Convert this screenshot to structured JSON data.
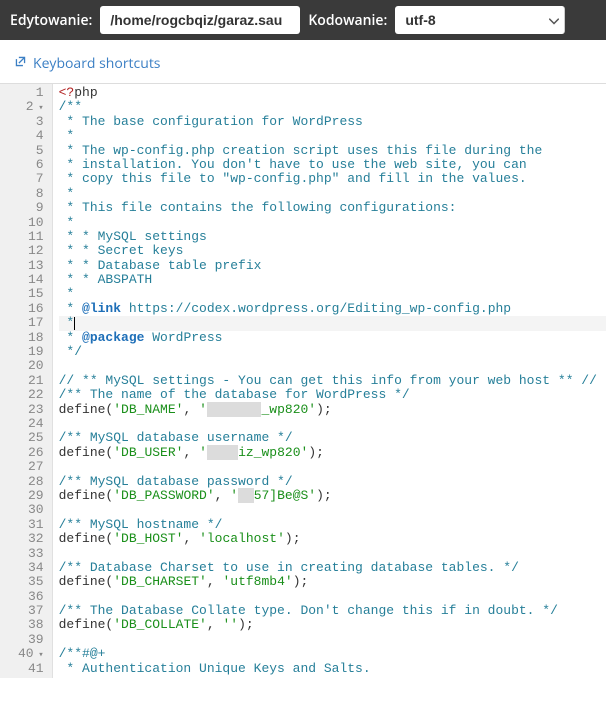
{
  "toolbar": {
    "editing_label": "Edytowanie:",
    "path": "/home/rogcbqiz/garaz.sau",
    "encoding_label": "Kodowanie:",
    "encoding_value": "utf-8"
  },
  "shortcuts": {
    "label": "Keyboard shortcuts"
  },
  "editor": {
    "active_line": 17,
    "fold_lines": [
      2,
      40
    ],
    "lines": [
      {
        "n": 1,
        "seg": [
          {
            "t": "<?",
            "c": "c-tag"
          },
          {
            "t": "php",
            "c": ""
          }
        ]
      },
      {
        "n": 2,
        "seg": [
          {
            "t": "/**",
            "c": "c-comment"
          }
        ]
      },
      {
        "n": 3,
        "seg": [
          {
            "t": " * The base configuration for WordPress",
            "c": "c-comment"
          }
        ]
      },
      {
        "n": 4,
        "seg": [
          {
            "t": " *",
            "c": "c-comment"
          }
        ]
      },
      {
        "n": 5,
        "seg": [
          {
            "t": " * The wp-config.php creation script uses this file during the",
            "c": "c-comment"
          }
        ]
      },
      {
        "n": 6,
        "seg": [
          {
            "t": " * installation. You don't have to use the web site, you can",
            "c": "c-comment"
          }
        ]
      },
      {
        "n": 7,
        "seg": [
          {
            "t": " * copy this file to \"wp-config.php\" and fill in the values.",
            "c": "c-comment"
          }
        ]
      },
      {
        "n": 8,
        "seg": [
          {
            "t": " *",
            "c": "c-comment"
          }
        ]
      },
      {
        "n": 9,
        "seg": [
          {
            "t": " * This file contains the following configurations:",
            "c": "c-comment"
          }
        ]
      },
      {
        "n": 10,
        "seg": [
          {
            "t": " *",
            "c": "c-comment"
          }
        ]
      },
      {
        "n": 11,
        "seg": [
          {
            "t": " * * MySQL settings",
            "c": "c-comment"
          }
        ]
      },
      {
        "n": 12,
        "seg": [
          {
            "t": " * * Secret keys",
            "c": "c-comment"
          }
        ]
      },
      {
        "n": 13,
        "seg": [
          {
            "t": " * * Database table prefix",
            "c": "c-comment"
          }
        ]
      },
      {
        "n": 14,
        "seg": [
          {
            "t": " * * ABSPATH",
            "c": "c-comment"
          }
        ]
      },
      {
        "n": 15,
        "seg": [
          {
            "t": " *",
            "c": "c-comment"
          }
        ]
      },
      {
        "n": 16,
        "seg": [
          {
            "t": " * ",
            "c": "c-comment"
          },
          {
            "t": "@link",
            "c": "c-doctag"
          },
          {
            "t": " https://codex.wordpress.org/Editing_wp-config.php",
            "c": "c-comment"
          }
        ]
      },
      {
        "n": 17,
        "seg": [
          {
            "t": " *",
            "c": "c-comment"
          },
          {
            "t": "",
            "c": "cursor"
          }
        ]
      },
      {
        "n": 18,
        "seg": [
          {
            "t": " * ",
            "c": "c-comment"
          },
          {
            "t": "@package",
            "c": "c-doctag"
          },
          {
            "t": " WordPress",
            "c": "c-comment"
          }
        ]
      },
      {
        "n": 19,
        "seg": [
          {
            "t": " */",
            "c": "c-comment"
          }
        ]
      },
      {
        "n": 20,
        "seg": [
          {
            "t": "",
            "c": ""
          }
        ]
      },
      {
        "n": 21,
        "seg": [
          {
            "t": "// ** MySQL settings - You can get this info from your web host ** //",
            "c": "c-comment"
          }
        ]
      },
      {
        "n": 22,
        "seg": [
          {
            "t": "/** The name of the database for WordPress */",
            "c": "c-comment"
          }
        ]
      },
      {
        "n": 23,
        "seg": [
          {
            "t": "define",
            "c": "c-func"
          },
          {
            "t": "(",
            "c": "c-paren"
          },
          {
            "t": "'DB_NAME'",
            "c": "c-string"
          },
          {
            "t": ", ",
            "c": ""
          },
          {
            "t": "'",
            "c": "c-string"
          },
          {
            "t": "XXXXXXX",
            "c": "c-redact"
          },
          {
            "t": "_wp820'",
            "c": "c-string"
          },
          {
            "t": ");",
            "c": ""
          }
        ]
      },
      {
        "n": 24,
        "seg": [
          {
            "t": "",
            "c": ""
          }
        ]
      },
      {
        "n": 25,
        "seg": [
          {
            "t": "/** MySQL database username */",
            "c": "c-comment"
          }
        ]
      },
      {
        "n": 26,
        "seg": [
          {
            "t": "define",
            "c": "c-func"
          },
          {
            "t": "(",
            "c": "c-paren"
          },
          {
            "t": "'DB_USER'",
            "c": "c-string"
          },
          {
            "t": ", ",
            "c": ""
          },
          {
            "t": "'",
            "c": "c-string"
          },
          {
            "t": "XXXX",
            "c": "c-redact"
          },
          {
            "t": "iz_wp820'",
            "c": "c-string"
          },
          {
            "t": ");",
            "c": ""
          }
        ]
      },
      {
        "n": 27,
        "seg": [
          {
            "t": "",
            "c": ""
          }
        ]
      },
      {
        "n": 28,
        "seg": [
          {
            "t": "/** MySQL database password */",
            "c": "c-comment"
          }
        ]
      },
      {
        "n": 29,
        "seg": [
          {
            "t": "define",
            "c": "c-func"
          },
          {
            "t": "(",
            "c": "c-paren"
          },
          {
            "t": "'DB_PASSWORD'",
            "c": "c-string"
          },
          {
            "t": ", ",
            "c": ""
          },
          {
            "t": "'",
            "c": "c-string"
          },
          {
            "t": "XX",
            "c": "c-redact"
          },
          {
            "t": "57]Be@S'",
            "c": "c-string"
          },
          {
            "t": ");",
            "c": ""
          }
        ]
      },
      {
        "n": 30,
        "seg": [
          {
            "t": "",
            "c": ""
          }
        ]
      },
      {
        "n": 31,
        "seg": [
          {
            "t": "/** MySQL hostname */",
            "c": "c-comment"
          }
        ]
      },
      {
        "n": 32,
        "seg": [
          {
            "t": "define",
            "c": "c-func"
          },
          {
            "t": "(",
            "c": "c-paren"
          },
          {
            "t": "'DB_HOST'",
            "c": "c-string"
          },
          {
            "t": ", ",
            "c": ""
          },
          {
            "t": "'localhost'",
            "c": "c-string"
          },
          {
            "t": ");",
            "c": ""
          }
        ]
      },
      {
        "n": 33,
        "seg": [
          {
            "t": "",
            "c": ""
          }
        ]
      },
      {
        "n": 34,
        "seg": [
          {
            "t": "/** Database Charset to use in creating database tables. */",
            "c": "c-comment"
          }
        ]
      },
      {
        "n": 35,
        "seg": [
          {
            "t": "define",
            "c": "c-func"
          },
          {
            "t": "(",
            "c": "c-paren"
          },
          {
            "t": "'DB_CHARSET'",
            "c": "c-string"
          },
          {
            "t": ", ",
            "c": ""
          },
          {
            "t": "'utf8mb4'",
            "c": "c-string"
          },
          {
            "t": ");",
            "c": ""
          }
        ]
      },
      {
        "n": 36,
        "seg": [
          {
            "t": "",
            "c": ""
          }
        ]
      },
      {
        "n": 37,
        "seg": [
          {
            "t": "/** The Database Collate type. Don't change this if in doubt. */",
            "c": "c-comment"
          }
        ]
      },
      {
        "n": 38,
        "seg": [
          {
            "t": "define",
            "c": "c-func"
          },
          {
            "t": "(",
            "c": "c-paren"
          },
          {
            "t": "'DB_COLLATE'",
            "c": "c-string"
          },
          {
            "t": ", ",
            "c": ""
          },
          {
            "t": "''",
            "c": "c-string"
          },
          {
            "t": ");",
            "c": ""
          }
        ]
      },
      {
        "n": 39,
        "seg": [
          {
            "t": "",
            "c": ""
          }
        ]
      },
      {
        "n": 40,
        "seg": [
          {
            "t": "/**#@+",
            "c": "c-comment"
          }
        ]
      },
      {
        "n": 41,
        "seg": [
          {
            "t": " * Authentication Unique Keys and Salts.",
            "c": "c-comment"
          }
        ]
      }
    ]
  }
}
